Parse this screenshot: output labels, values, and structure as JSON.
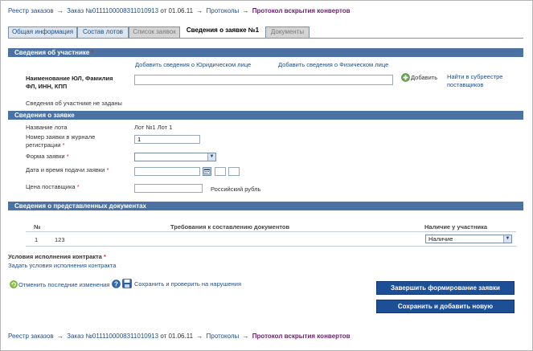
{
  "breadcrumb": {
    "registry": "Реестр заказов",
    "order": "Заказ №0111100008311010913",
    "order_date": "от 01.06.11",
    "protocols": "Протоколы",
    "current": "Протокол вскрытия конвертов",
    "arrow": "→"
  },
  "tabs": [
    {
      "label": "Общая информация"
    },
    {
      "label": "Состав лотов"
    },
    {
      "label": "Список заявок"
    },
    {
      "label": "Сведения о заявке №1"
    },
    {
      "label": "Документы"
    }
  ],
  "participant": {
    "title": "Сведения об участнике",
    "title_star": "*",
    "add_legal": "Добавить сведения о Юридическом лице",
    "add_physical": "Добавить сведения о Физическом лице",
    "name_label": "Наименование ЮЛ, Фамилия ФЛ, ИНН, КПП",
    "name_value": "",
    "add_button": "Добавить",
    "find_link": "Найти в субреестре поставщиков",
    "empty_note": "Сведения об участнике не заданы"
  },
  "application": {
    "title": "Сведения о заявке",
    "lot_label": "Название лота",
    "lot_value": "Лот №1 Лот 1",
    "reg_number_label": "Номер заявки в журнале регистрации",
    "reg_number_value": "1",
    "form_label": "Форма заявки",
    "form_value": "",
    "date_label": "Дата и время подачи заявки",
    "date_value": "",
    "hour_value": "",
    "minute_value": "",
    "price_label": "Цена поставщика",
    "price_value": "",
    "currency": "Российский рубль",
    "required_mark": "*"
  },
  "documents": {
    "title": "Сведения о представленных документах",
    "columns": [
      "№",
      "Требования к составлению документов",
      "Наличие у участника"
    ],
    "rows": [
      {
        "num": "1",
        "requirement": "123",
        "availability": "Наличие"
      }
    ]
  },
  "contract": {
    "label": "Условия исполнения контракта",
    "required_mark": "*",
    "link": "Задать условия исполнения контракта"
  },
  "actions": {
    "undo": "Отменить последние изменения",
    "save_check": "Сохранить и проверить на нарушения",
    "finish": "Завершить формирование заявки",
    "save_new": "Сохранить и добавить новую"
  },
  "colors": {
    "section_bar": "#4b72a3",
    "button": "#1d4f96",
    "link": "#1f4e8c",
    "current_crumb": "#6b1f6f",
    "required": "#d42a2a"
  }
}
